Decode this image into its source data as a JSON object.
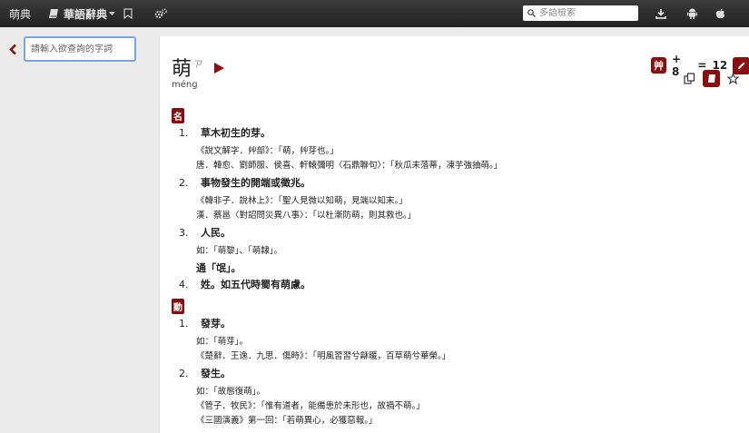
{
  "topbar": {
    "logo_text": "萌典",
    "dict_name": "華語辭典",
    "search_placeholder": "多語檢索"
  },
  "sidebar": {
    "query_placeholder": "請輸入欲查詢的字詞"
  },
  "entry": {
    "character": "萌",
    "stroke_hint": "ㄗ",
    "pinyin": "méng",
    "radical": "艸",
    "plus_label": "+ 8",
    "equals_label": "=",
    "total_strokes": "12",
    "senses": [
      {
        "pos": "名",
        "defs": [
          {
            "num": "1.",
            "text": "草木初生的芽。",
            "examples": [
              "《說文解字．艸部》：「萌，艸芽也。」",
              "唐．韓愈、劉師服、侯喜、軒轅彌明〈石鼎聯句〉：「秋瓜未落蒂，凍芋強抽萌。」"
            ]
          },
          {
            "num": "2.",
            "text": "事物發生的開端或徵兆。",
            "examples": [
              "《韓非子．說林上》：「聖人見微以知萌，見端以知末。」",
              "漢．蔡邕〈對詔問災異八事〉：「以杜漸防萌，則其救也。」"
            ]
          },
          {
            "num": "3.",
            "text": "人民。",
            "examples": [
              "如：「萌黎」、「萌隸」。"
            ],
            "tong": "通「氓」。"
          },
          {
            "num": "4.",
            "text": "姓。如五代時蜀有萌慮。",
            "examples": []
          }
        ]
      },
      {
        "pos": "動",
        "defs": [
          {
            "num": "1.",
            "text": "發芽。",
            "examples": [
              "如：「萌芽」。",
              "《楚辭．王逸．九思．傷時》：「明風習習兮龢暖，百草萌兮華榮。」"
            ]
          },
          {
            "num": "2.",
            "text": "發生。",
            "examples": [
              "如：「故態復萌」。",
              "《管子．牧民》：「惟有道者，能備患於未形也，故禍不萌。」",
              "《三國演義》第一回：「若萌異心，必獲惡報。」"
            ]
          }
        ]
      }
    ]
  },
  "colors": {
    "accent": "#8b0e0e",
    "topbar": "#2a2a2a",
    "focus": "#7aa6e0"
  },
  "icons": [
    "dictionary-book-icon",
    "caret-down-icon",
    "bookmark-icon",
    "gears-icon",
    "search-icon",
    "download-icon",
    "android-icon",
    "apple-icon",
    "chevron-left-icon",
    "play-icon",
    "pencil-icon",
    "copy-icon",
    "book-icon",
    "star-icon"
  ]
}
